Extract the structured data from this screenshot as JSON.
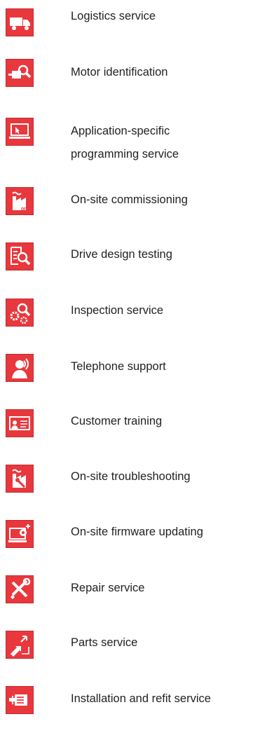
{
  "services": [
    {
      "label": "Logistics service",
      "icon": "truck-icon"
    },
    {
      "label": "Motor identification",
      "icon": "motor-search-icon"
    },
    {
      "label": "Application-specific",
      "label2": "programming service",
      "icon": "laptop-icon"
    },
    {
      "label": "On-site commissioning",
      "icon": "factory-on-icon"
    },
    {
      "label": "Drive design testing",
      "icon": "document-search-icon"
    },
    {
      "label": "Inspection service",
      "icon": "gear-search-icon"
    },
    {
      "label": "Telephone support",
      "icon": "headset-person-icon"
    },
    {
      "label": "Customer training",
      "icon": "presentation-board-icon"
    },
    {
      "label": "On-site troubleshooting",
      "icon": "factory-wrench-icon"
    },
    {
      "label": "On-site firmware updating",
      "icon": "monitor-update-icon"
    },
    {
      "label": "Repair service",
      "icon": "tools-icon"
    },
    {
      "label": "Parts service",
      "icon": "exchange-arrows-icon"
    },
    {
      "label": "Installation and refit service",
      "icon": "motor-install-icon"
    }
  ],
  "colors": {
    "icon_bg": "#e8383d",
    "icon_border": "#c42a2f",
    "text": "#222222"
  }
}
